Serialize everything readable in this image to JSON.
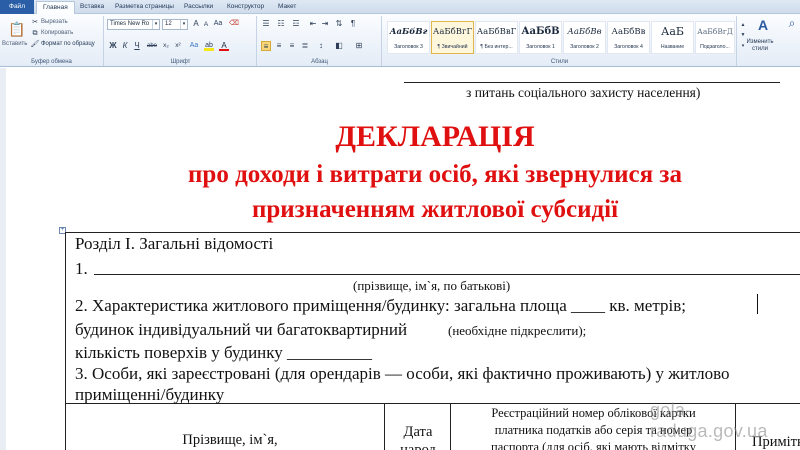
{
  "ribbon": {
    "tabs": [
      "Файл",
      "Главная",
      "Вставка",
      "Разметка страницы",
      "Рассылки",
      "Конструктор",
      "Макет"
    ],
    "clipboard": {
      "paste": "Вставить",
      "cut": "Вырезать",
      "copy": "Копировать",
      "format_painter": "Формат по образцу",
      "label": "Буфер обмена"
    },
    "font": {
      "name": "Times New Ro",
      "size": "12",
      "label": "Шрифт",
      "buttons": [
        "Ж",
        "К",
        "Ч",
        "abe",
        "x₂",
        "x²",
        "Aa",
        "A"
      ]
    },
    "paragraph": {
      "label": "Абзац"
    },
    "styles": {
      "label": "Стили",
      "tiles": [
        {
          "sample": "АаБбВг",
          "name": "Заголовок 3"
        },
        {
          "sample": "АаБбВгГ",
          "name": "¶ Звичайний"
        },
        {
          "sample": "АаБбВвГ",
          "name": "¶ Без интер..."
        },
        {
          "sample": "АаБбВ",
          "name": "Заголовок 1"
        },
        {
          "sample": "АаБбВв",
          "name": "Заголовок 2"
        },
        {
          "sample": "АаБбВв",
          "name": "Заголовок 4"
        },
        {
          "sample": "АаБ",
          "name": "Название"
        },
        {
          "sample": "АаБбВгД",
          "name": "Подзаголо..."
        }
      ],
      "change_styles": "Изменить стили"
    }
  },
  "document": {
    "header_text": "з питань соціального захисту населення)",
    "title_line1": "ДЕКЛАРАЦІЯ",
    "title_line2": "про доходи і витрати осіб, які звернулися за",
    "title_line3": "призначенням житлової субсидії",
    "section1_title": "Розділ І. Загальні відомості",
    "item1": "1.",
    "item1_caption": "(прізвище, ім`я, по батькові)",
    "item2_line1": "2. Характеристика житлового приміщення/будинку:  загальна площа ____ кв. метрів;",
    "item2_line2a": "будинок  індивідуальний чи багатоквартирний",
    "item2_line2b": "(необхідне підкреслити);",
    "item2_line3": "кількість поверхів у будинку __________",
    "item3_line1": "3. Особи, які зареєстровані (для орендарів — особи, які фактично проживають) у житлово",
    "item3_line2": "приміщенні/будинку",
    "table_col1": "Прізвище, ім`я,",
    "table_col2_l1": "Дата",
    "table_col2_l2": "народ",
    "table_col3_l1": "Реєстраційний номер облікової картки",
    "table_col3_l2": "платника податків або серія та номер",
    "table_col3_l3": "паспорта (для осіб, які мають відмітку",
    "table_col4": "Примітк",
    "watermark": "gola-raduga.gov.ua"
  }
}
